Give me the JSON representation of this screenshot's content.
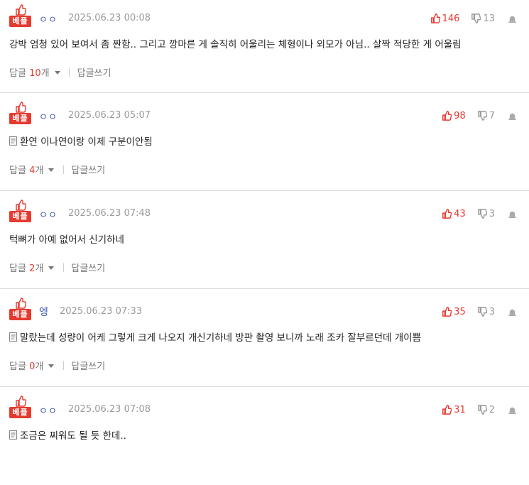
{
  "best_label": "베플",
  "reply_label": "답글",
  "reply_unit": "개",
  "write_reply_label": "답글쓰기",
  "colors": {
    "accent": "#e53a2f",
    "nick": "#3b5aa6",
    "muted": "#9a9a9a"
  },
  "comments": [
    {
      "nick": "ㅇㅇ",
      "time": "2025.06.23 00:08",
      "text": "강박 엄청 있어 보여서 좀 짠함.. 그리고 깡마른 게 솔직히 어울리는 체형이나 외모가 아님.. 살짝 적당한 게 어울림",
      "up": "146",
      "down": "13",
      "replies": "10",
      "has_doc": false
    },
    {
      "nick": "ㅇㅇ",
      "time": "2025.06.23 05:07",
      "text": "환연 이나연이랑 이제 구분이안됨",
      "up": "98",
      "down": "7",
      "replies": "4",
      "has_doc": true
    },
    {
      "nick": "ㅇㅇ",
      "time": "2025.06.23 07:48",
      "text": "턱뼈가 아예 없어서 신기하네",
      "up": "43",
      "down": "3",
      "replies": "2",
      "has_doc": false
    },
    {
      "nick": "엥",
      "time": "2025.06.23 07:33",
      "text": "말랐는데 성량이 어케 그렇게 크게 나오지 개신기하네 방판 촬영 보니까 노래 조카 잘부르던데 개이쁨",
      "up": "35",
      "down": "3",
      "replies": "0",
      "has_doc": true
    },
    {
      "nick": "ㅇㅇ",
      "time": "2025.06.23 07:08",
      "text": "조금은 찌워도 될 듯 한데..",
      "up": "31",
      "down": "2",
      "replies": "",
      "has_doc": true
    }
  ]
}
